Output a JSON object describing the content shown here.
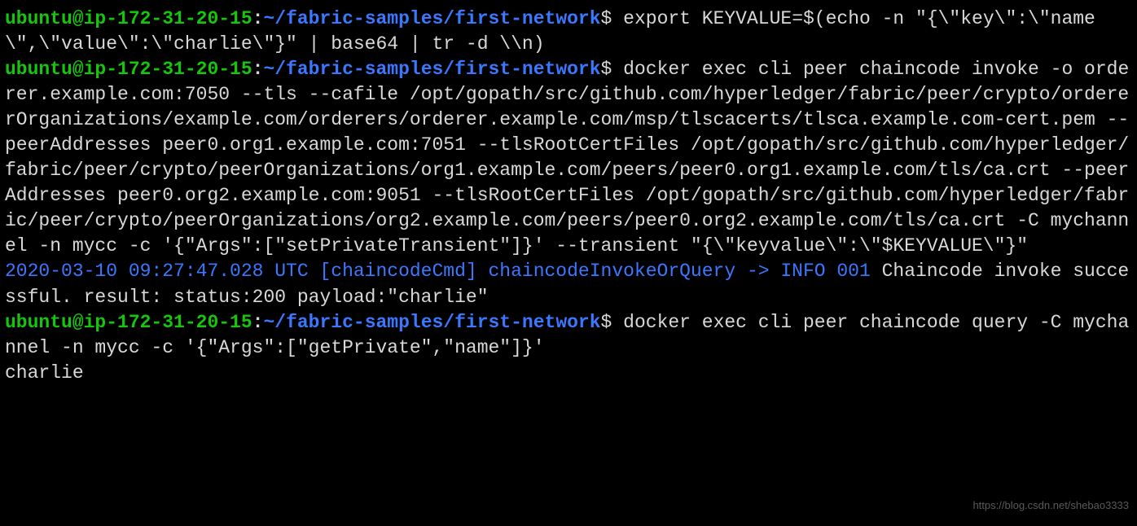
{
  "prompt": {
    "user": "ubuntu@ip-172-31-20-15",
    "colon": ":",
    "path": "~/fabric-samples/first-network",
    "symbol": "$"
  },
  "lines": {
    "cmd1": " export KEYVALUE=$(echo -n \"{\\\"key\\\":\\\"name\\\",\\\"value\\\":\\\"charlie\\\"}\" | base64 | tr -d \\\\n)",
    "cmd2": " docker exec cli peer chaincode invoke -o orderer.example.com:7050 --tls --cafile /opt/gopath/src/github.com/hyperledger/fabric/peer/crypto/ordererOrganizations/example.com/orderers/orderer.example.com/msp/tlscacerts/tlsca.example.com-cert.pem --peerAddresses peer0.org1.example.com:7051 --tlsRootCertFiles /opt/gopath/src/github.com/hyperledger/fabric/peer/crypto/peerOrganizations/org1.example.com/peers/peer0.org1.example.com/tls/ca.crt --peerAddresses peer0.org2.example.com:9051 --tlsRootCertFiles /opt/gopath/src/github.com/hyperledger/fabric/peer/crypto/peerOrganizations/org2.example.com/peers/peer0.org2.example.com/tls/ca.crt -C mychannel -n mycc -c '{\"Args\":[\"setPrivateTransient\"]}' --transient \"{\\\"keyvalue\\\":\\\"$KEYVALUE\\\"}\"",
    "log_prefix": "2020-03-10 09:27:47.028 UTC [chaincodeCmd] chaincodeInvokeOrQuery -> INFO 001",
    "log_msg": " Chaincode invoke successful. result: status:200 payload:\"charlie\"",
    "cmd3": " docker exec cli peer chaincode query -C mychannel -n mycc -c '{\"Args\":[\"getPrivate\",\"name\"]}'",
    "output": "charlie"
  },
  "watermark": "https://blog.csdn.net/shebao3333"
}
